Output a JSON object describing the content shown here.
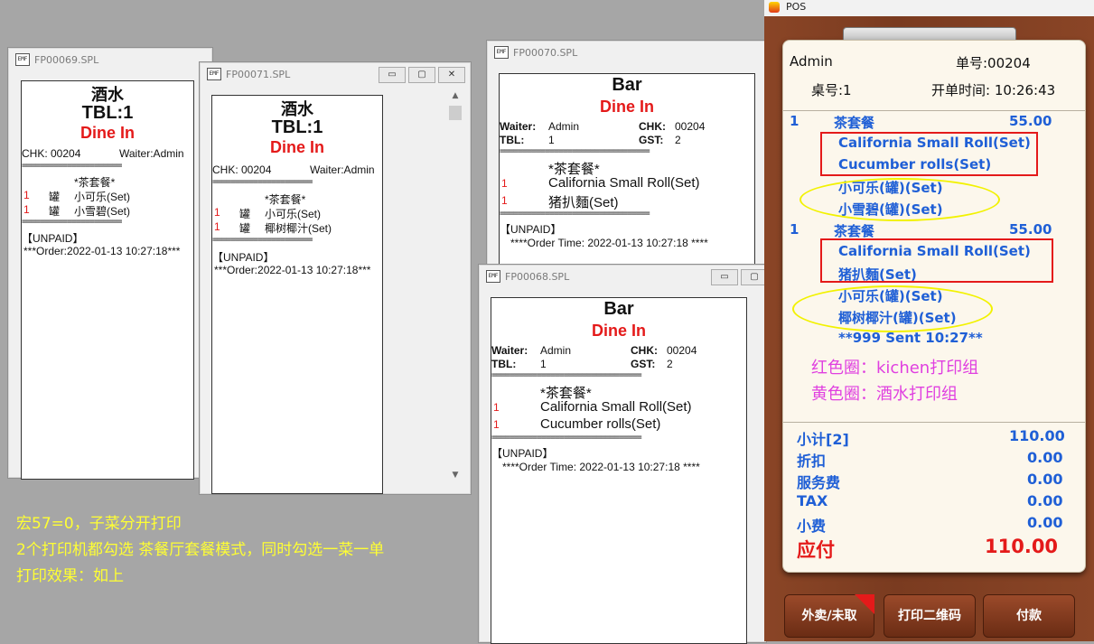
{
  "w69": {
    "title": "FP00069.SPL",
    "t1": "酒水",
    "t2": "TBL:1",
    "t3": "Dine In",
    "chk": "CHK:  00204",
    "waiter": "Waiter:Admin",
    "dash": "======================",
    "set": "*茶套餐*",
    "item1": {
      "qty": "1",
      "unit": "罐",
      "name": "小可乐(Set)"
    },
    "item2": {
      "qty": "1",
      "unit": "罐",
      "name": "小雪碧(Set)"
    },
    "unpaid": "【UNPAID】",
    "order": "***Order:2022-01-13 10:27:18***"
  },
  "w71": {
    "title": "FP00071.SPL",
    "t1": "酒水",
    "t2": "TBL:1",
    "t3": "Dine In",
    "chk": "CHK:  00204",
    "waiter": "Waiter:Admin",
    "dash": "======================",
    "set": "*茶套餐*",
    "item1": {
      "qty": "1",
      "unit": "罐",
      "name": "小可乐(Set)"
    },
    "item2": {
      "qty": "1",
      "unit": "罐",
      "name": "椰树椰汁(Set)"
    },
    "unpaid": "【UNPAID】",
    "order": "***Order:2022-01-13 10:27:18***"
  },
  "w70": {
    "title": "FP00070.SPL",
    "t1": "Bar",
    "t3": "Dine In",
    "waiter_k": "Waiter:",
    "waiter_v": "Admin",
    "chk_k": "CHK:",
    "chk_v": "00204",
    "tbl_k": "TBL:",
    "tbl_v": "1",
    "gst_k": "GST:",
    "gst_v": "2",
    "dash": "=================================",
    "set": "*茶套餐*",
    "item1": {
      "qty": "1",
      "name": "California Small Roll(Set)"
    },
    "item2": {
      "qty": "1",
      "name": "猪扒麵(Set)"
    },
    "unpaid": "【UNPAID】",
    "order": "****Order Time: 2022-01-13 10:27:18 ****"
  },
  "w68": {
    "title": "FP00068.SPL",
    "t1": "Bar",
    "t3": "Dine In",
    "waiter_k": "Waiter:",
    "waiter_v": "Admin",
    "chk_k": "CHK:",
    "chk_v": "00204",
    "tbl_k": "TBL:",
    "tbl_v": "1",
    "gst_k": "GST:",
    "gst_v": "2",
    "dash": "=================================",
    "set": "*茶套餐*",
    "item1": {
      "qty": "1",
      "name": "California Small Roll(Set)"
    },
    "item2": {
      "qty": "1",
      "name": "Cucumber rolls(Set)"
    },
    "unpaid": "【UNPAID】",
    "order": "****Order Time: 2022-01-13 10:27:18 ****"
  },
  "notes": [
    "宏57=0，子菜分开打印",
    "2个打印机都勾选 茶餐厅套餐模式，同时勾选一菜一单",
    "打印效果：如上"
  ],
  "pos": {
    "title": "POS",
    "user": "Admin",
    "order_no": "单号:00204",
    "table": "桌号:1",
    "open_time": "开单时间: 10:26:43",
    "group1": {
      "qty": "1",
      "name": "茶套餐",
      "price": "55.00",
      "items": [
        "California Small Roll(Set)",
        "Cucumber rolls(Set)",
        "小可乐(罐)(Set)",
        "小雪碧(罐)(Set)"
      ]
    },
    "group2": {
      "qty": "1",
      "name": "茶套餐",
      "price": "55.00",
      "items": [
        "California Small Roll(Set)",
        "猪扒麵(Set)",
        "小可乐(罐)(Set)",
        "椰树椰汁(罐)(Set)"
      ]
    },
    "sent": "**999 Sent 10:27**",
    "legend_red": "红色圈：kichen打印组",
    "legend_yellow": "黄色圈：酒水打印组",
    "subtotal_label": "小计[2]",
    "subtotal": "110.00",
    "discount_label": "折扣",
    "discount": "0.00",
    "service_label": "服务费",
    "service": "0.00",
    "tax_label": "TAX",
    "tax": "0.00",
    "tip_label": "小费",
    "tip": "0.00",
    "due_label": "应付",
    "due": "110.00",
    "btn_takeout": "外卖/未取",
    "btn_qr": "打印二维码",
    "btn_pay": "付款",
    "colors": {
      "blue": "#1f5fd6",
      "red": "#e41a1a",
      "magenta": "#e040e0",
      "yellow": "#ffff33"
    }
  }
}
